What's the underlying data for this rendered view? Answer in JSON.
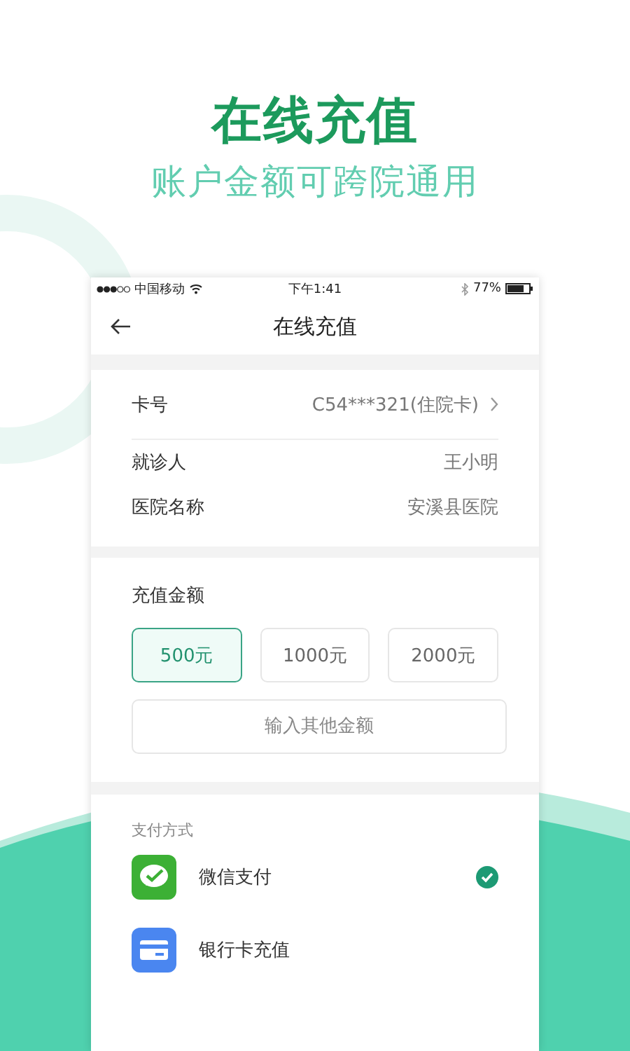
{
  "headline": "在线充值",
  "subtitle": "账户金额可跨院通用",
  "status_bar": {
    "carrier": "中国移动",
    "time": "下午1:41",
    "battery": "77%"
  },
  "nav": {
    "title": "在线充值"
  },
  "info_rows": [
    {
      "label": "卡号",
      "value": "C54***321(住院卡)",
      "chevron": true
    },
    {
      "label": "就诊人",
      "value": "王小明",
      "chevron": false
    },
    {
      "label": "医院名称",
      "value": "安溪县医院",
      "chevron": false
    }
  ],
  "amount": {
    "title": "充值金额",
    "options": [
      {
        "label": "500元",
        "selected": true
      },
      {
        "label": "1000元",
        "selected": false
      },
      {
        "label": "2000元",
        "selected": false
      }
    ],
    "other_placeholder": "输入其他金额"
  },
  "payment": {
    "title": "支付方式",
    "methods": [
      {
        "kind": "wechat",
        "label": "微信支付",
        "selected": true
      },
      {
        "kind": "bank",
        "label": "银行卡充值",
        "selected": false
      }
    ]
  }
}
